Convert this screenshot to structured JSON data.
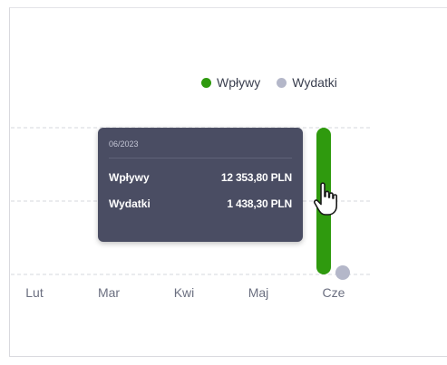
{
  "legend": {
    "inflows_label": "Wpływy",
    "outflows_label": "Wydatki"
  },
  "colors": {
    "inflows": "#2f9a0e",
    "outflows": "#b4b7c9",
    "tooltip_bg": "#4a4d63"
  },
  "tooltip": {
    "date": "06/2023",
    "rows": [
      {
        "label": "Wpływy",
        "value": "12 353,80 PLN"
      },
      {
        "label": "Wydatki",
        "value": "1 438,30 PLN"
      }
    ]
  },
  "cursor_icon": "hand-pointer-icon",
  "chart_data": {
    "type": "bar",
    "categories": [
      "Lut",
      "Mar",
      "Kwi",
      "Maj",
      "Cze"
    ],
    "series": [
      {
        "name": "Wpływy",
        "values": [
          0,
          0,
          0,
          0,
          12353.8
        ]
      },
      {
        "name": "Wydatki",
        "values": [
          0,
          0,
          0,
          0,
          1438.3
        ]
      }
    ],
    "unit": "PLN",
    "grid": true,
    "legend_position": "top-right",
    "ylim": [
      0,
      12353.8
    ]
  }
}
